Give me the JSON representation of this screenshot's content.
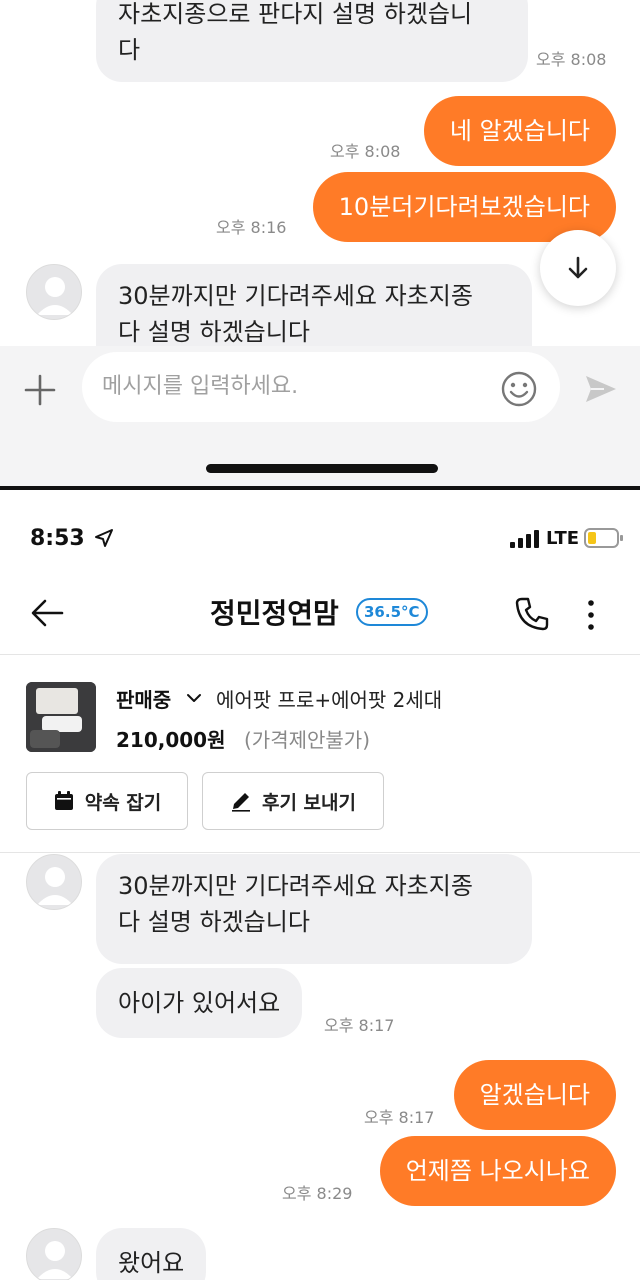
{
  "top_screen": {
    "messages": [
      {
        "text_line1": "자초지종으로 판다지 설명 하겠습니",
        "text_line2": "다",
        "time": "오후 8:08"
      },
      {
        "text": "네 알겠습니다",
        "time": "오후 8:08"
      },
      {
        "text": "10분더기다려보겠습니다",
        "time": "오후 8:16"
      },
      {
        "text_line1": "30분까지만 기다려주세요 자초지종",
        "text_line2": "다 설명 하겠습니다"
      }
    ],
    "input_placeholder": "메시지를 입력하세요."
  },
  "status_bar": {
    "time": "8:53",
    "network": "LTE"
  },
  "header": {
    "title": "정민정연맘",
    "temperature": "36.5°C"
  },
  "product": {
    "status": "판매중",
    "title": "에어팟 프로+에어팟 2세대",
    "price": "210,000원",
    "price_note": "(가격제안불가)"
  },
  "actions": {
    "appointment": "약속 잡기",
    "review": "후기 보내기"
  },
  "bottom_messages": [
    {
      "text_line1": "30분까지만 기다려주세요 자초지종",
      "text_line2": "다 설명 하겠습니다"
    },
    {
      "text": "아이가 있어서요",
      "time": "오후 8:17"
    },
    {
      "text": "알겠습니다",
      "time": "오후 8:17"
    },
    {
      "text": "언제쯤 나오시나요",
      "time": "오후 8:29"
    },
    {
      "text": "왔어요"
    }
  ],
  "colors": {
    "accent": "#ff7b27",
    "temperature": "#1e88d8",
    "incoming_bubble": "#f0f0f2"
  }
}
